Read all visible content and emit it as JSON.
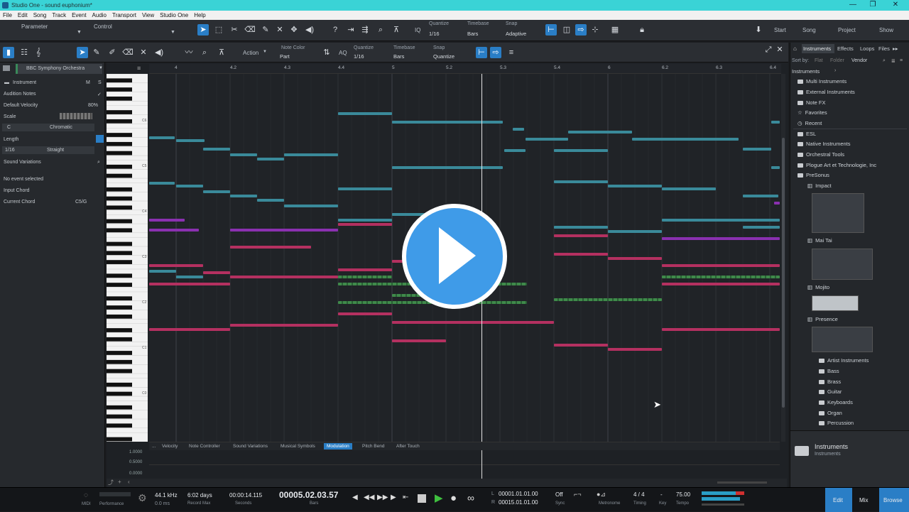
{
  "window": {
    "title": "Studio One - sound euphonium*",
    "controls": [
      "—",
      "❐",
      "✕"
    ]
  },
  "menu": [
    "File",
    "Edit",
    "Song",
    "Track",
    "Event",
    "Audio",
    "Transport",
    "View",
    "Studio One",
    "Help"
  ],
  "main_toolbar": {
    "parameter_label": "Parameter",
    "control_label": "Control",
    "quantize": {
      "label": "Quantize",
      "value": "1/16"
    },
    "timebase": {
      "label": "Timebase",
      "value": "Bars"
    },
    "snap": {
      "label": "Snap",
      "value": "Adaptive"
    },
    "nav": [
      "Start",
      "Song",
      "Project",
      "Show"
    ]
  },
  "editor_toolbar": {
    "action_label": "Action",
    "note_color": {
      "label": "Note Color",
      "value": "Part"
    },
    "quantize": {
      "label": "Quantize",
      "value": "1/16"
    },
    "timebase": {
      "label": "Timebase",
      "value": "Bars"
    },
    "snap": {
      "label": "Snap",
      "value": "Quantize"
    },
    "aq_label": "AQ"
  },
  "left_panel": {
    "track_name": "BBC Symphony Orchestra",
    "instrument_label": "Instrument",
    "m_label": "M",
    "s_label": "S",
    "audition_notes": "Audition Notes",
    "default_velocity_label": "Default Velocity",
    "default_velocity": "80%",
    "scale_label": "Scale",
    "scale_root": "C",
    "scale_type": "Chromatic",
    "length_label": "Length",
    "length_value": "1/16",
    "length_mode": "Straight",
    "sound_variations": "Sound Variations",
    "no_event": "No event selected",
    "input_chord": "Input Chord",
    "current_chord_label": "Current Chord",
    "current_chord": "C5/G"
  },
  "ruler": [
    "4",
    "4.2",
    "4.3",
    "4.4",
    "5",
    "5.2",
    "5.3",
    "5.4",
    "6",
    "6.2",
    "6.3",
    "6.4"
  ],
  "key_labels": [
    "C6",
    "C5",
    "C4",
    "C3",
    "C2",
    "C1",
    "C0"
  ],
  "lower_tabs": [
    "...",
    "Velocity",
    "Note Controller",
    "Sound Variations",
    "Musical Symbols",
    "Modulation",
    "Pitch Bend",
    "After Touch"
  ],
  "lower_tabs_active": "Modulation",
  "lane_values": [
    "1.0000",
    "0.5000",
    "0.0000"
  ],
  "browser": {
    "tabs": [
      "Instruments",
      "Effects",
      "Loops",
      "Files"
    ],
    "sort_by": "Sort by:",
    "sort_options": [
      "Flat",
      "Folder",
      "Vendor"
    ],
    "breadcrumb": "Instruments",
    "items": [
      "Multi Instruments",
      "External Instruments",
      "Note FX",
      "Favorites",
      "Recent",
      "ESL",
      "Native Instruments",
      "Orchestral Tools",
      "Plogue Art et Technologie, Inc",
      "PreSonus"
    ],
    "presonus_children": [
      "Impact",
      "Mai Tai",
      "Mojito",
      "Presence"
    ],
    "presence_children": [
      "Artist Instruments",
      "Bass",
      "Brass",
      "Guitar",
      "Keyboards",
      "Organ",
      "Percussion"
    ],
    "footer_title": "Instruments",
    "footer_sub": "Instruments"
  },
  "transport": {
    "midi_label": "MIDI",
    "performance_label": "Performance",
    "sample_rate": "44.1 kHz",
    "latency": "0.0 ms",
    "record_max": "6:02 days",
    "record_max_label": "Record Max",
    "seconds": "00:00:14.115",
    "seconds_label": "Seconds",
    "bars": "00005.02.03.57",
    "bars_label": "Bars",
    "loop_start": "00001.01.01.00",
    "loop_end": "00015.01.01.00",
    "sync_value": "Off",
    "sync_label": "Sync",
    "metronome_label": "Metronome",
    "timing": "4 / 4",
    "timing_label": "Timing",
    "key_value": "-",
    "key_label": "Key",
    "tempo": "75.00",
    "tempo_label": "Tempo",
    "buttons": [
      "Edit",
      "Mix",
      "Browse"
    ]
  },
  "colors": {
    "teal": "#3a8a9a",
    "pink": "#b43060",
    "green": "#3f8a4a",
    "purple": "#8a30b0",
    "accent": "#2a7ec6"
  }
}
